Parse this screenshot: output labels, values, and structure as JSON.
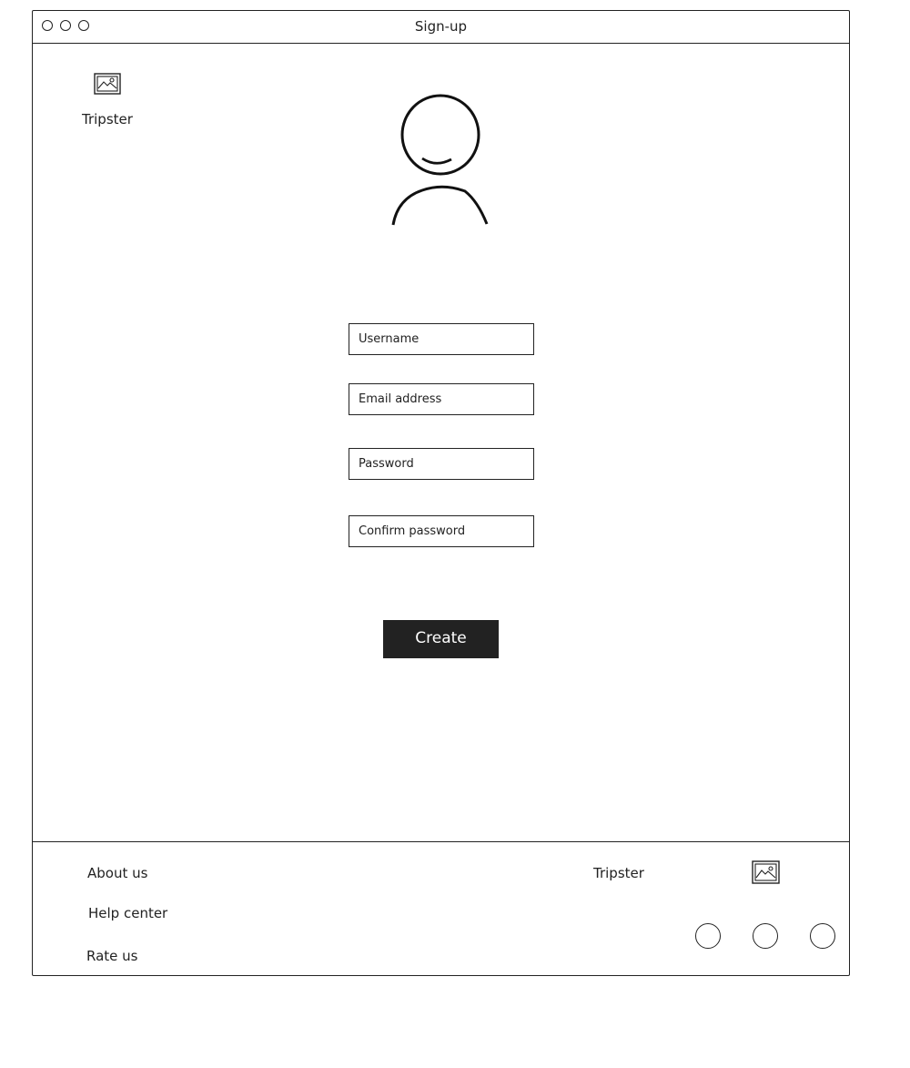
{
  "window": {
    "title": "Sign-up"
  },
  "brand": {
    "name_top": "Tripster",
    "name_bottom": "Tripster",
    "logo_icon": "image-icon"
  },
  "avatar": {
    "icon": "user-avatar-icon"
  },
  "form": {
    "username_placeholder": "Username",
    "email_placeholder": "Email address",
    "password_placeholder": "Password",
    "confirm_placeholder": "Confirm password",
    "create_label": "Create"
  },
  "footer": {
    "links": [
      "About us",
      "Help center",
      "Rate us"
    ],
    "social_icons": [
      "circle-icon",
      "circle-icon",
      "circle-icon"
    ]
  }
}
